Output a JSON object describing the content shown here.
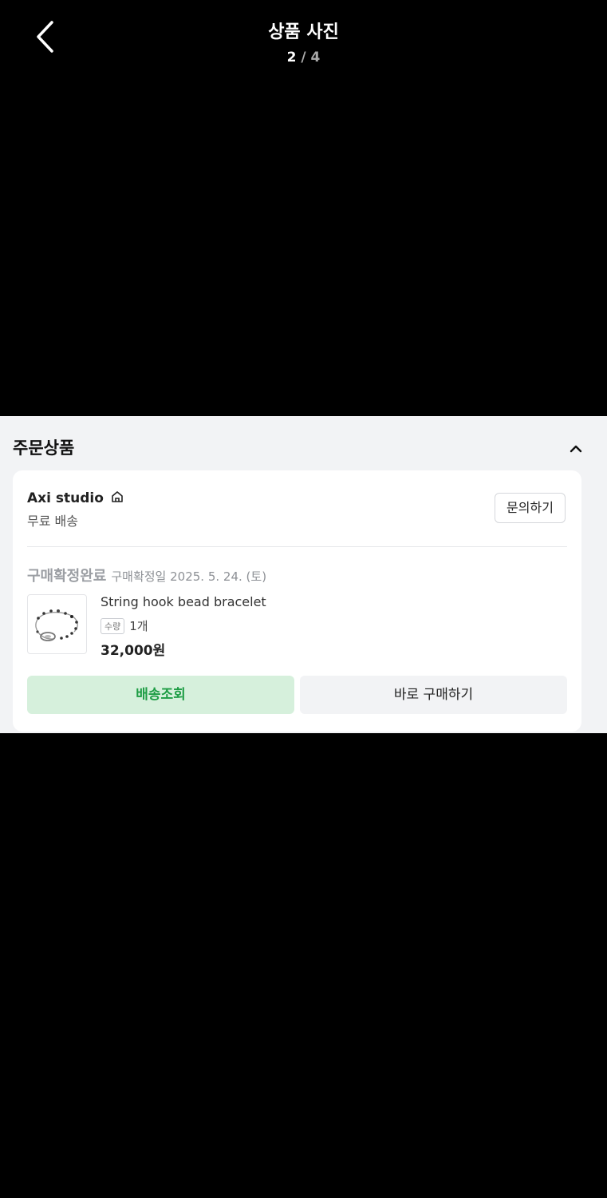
{
  "header": {
    "title": "상품 사진",
    "current": "2",
    "separator": "/",
    "total": "4"
  },
  "order_panel": {
    "heading": "주문상품",
    "shop": {
      "name": "Axi studio",
      "shipping": "무료 배송",
      "inquiry_label": "문의하기"
    },
    "status": {
      "label": "구매확정완료",
      "date_text": "구매확정일 2025. 5. 24. (토)"
    },
    "product": {
      "name": "String hook bead bracelet",
      "qty_badge": "수량",
      "qty_value": "1개",
      "price": "32,000원"
    },
    "buttons": {
      "track": "배송조회",
      "buy_again": "바로 구매하기"
    }
  },
  "colors": {
    "background": "#000000",
    "panel": "#f2f3f5",
    "accent_green": "#1e9d45",
    "accent_green_bg": "#d6f0dc"
  }
}
